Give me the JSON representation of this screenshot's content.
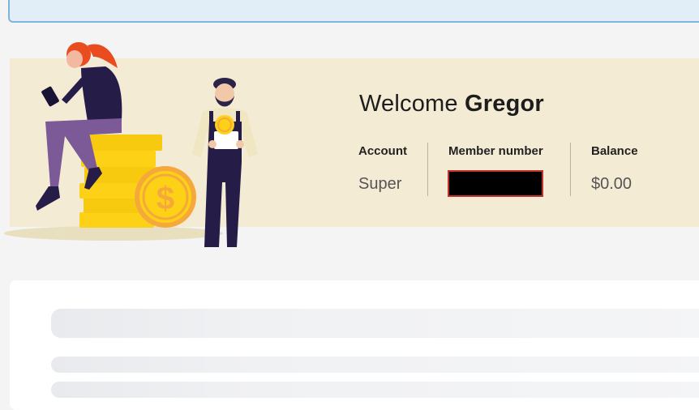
{
  "welcome": {
    "greeting": "Welcome",
    "user_name": "Gregor"
  },
  "stats": {
    "account_label": "Account",
    "account_value": "Super",
    "member_label": "Member number",
    "balance_label": "Balance",
    "balance_value": "$0.00"
  },
  "colors": {
    "banner_bg": "#f4ebd5",
    "notice_border": "#7fb5d9",
    "coin": "#fcd116",
    "redaction": "#000000"
  }
}
